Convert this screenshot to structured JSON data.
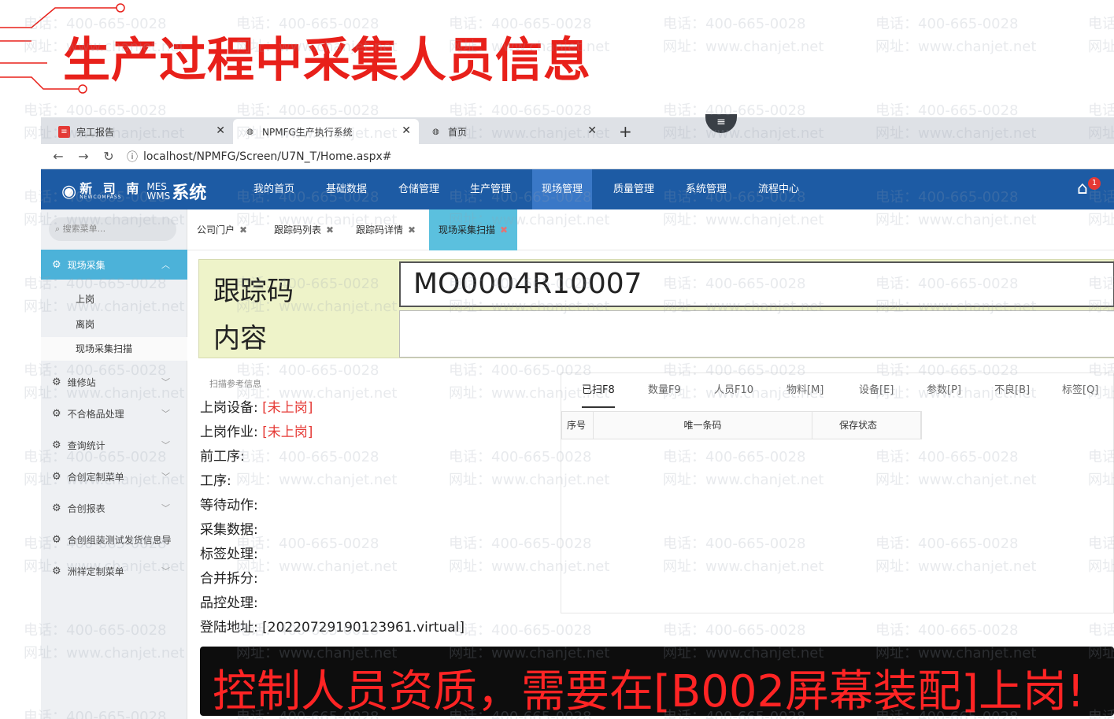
{
  "slide_title": "生产过程中采集人员信息",
  "watermark": {
    "phone": "电话：400-665-0028",
    "site": "网址：www.chanjet.net"
  },
  "browser": {
    "tabs": [
      {
        "label": "完工报告",
        "icon": "app-favicon-red"
      },
      {
        "label": "NPMFG生产执行系统",
        "icon": "globe-icon"
      },
      {
        "label": "首页",
        "icon": "globe-icon"
      }
    ],
    "new_tab_label": "+",
    "url": "localhost/NPMFG/Screen/U7N_T/Home.aspx#"
  },
  "app": {
    "logo": {
      "brand": "新 司 南",
      "brand_en": "NEWCOMPASS",
      "mes": "MES",
      "wms": "WMS",
      "system": "系统"
    },
    "nav": [
      "我的首页",
      "基础数据",
      "仓储管理",
      "生产管理",
      "现场管理",
      "质量管理",
      "系统管理",
      "流程中心"
    ],
    "active_nav": "现场管理",
    "notification_count": "1",
    "search_placeholder": "搜索菜单...",
    "sidebar": [
      {
        "label": "现场采集",
        "children": [
          "上岗",
          "离岗",
          "现场采集扫描"
        ]
      },
      {
        "label": "维修站"
      },
      {
        "label": "不合格品处理"
      },
      {
        "label": "查询统计"
      },
      {
        "label": "合创定制菜单"
      },
      {
        "label": "合创报表"
      },
      {
        "label": "合创组装测试发货信息导"
      },
      {
        "label": "洲祥定制菜单"
      }
    ],
    "page_tabs": [
      "公司门户",
      "跟踪码列表",
      "跟踪码详情",
      "现场采集扫描"
    ],
    "scan": {
      "trace_label": "跟踪码",
      "content_label": "内容",
      "trace_value": "MO0004R10007"
    },
    "info": {
      "title": "扫描参考信息",
      "rows": [
        {
          "label": "上岗设备:",
          "value": "[未上岗]"
        },
        {
          "label": "上岗作业:",
          "value": "[未上岗]"
        },
        {
          "label": "前工序:",
          "value": ""
        },
        {
          "label": "工序:",
          "value": ""
        },
        {
          "label": "等待动作:",
          "value": ""
        },
        {
          "label": "采集数据:",
          "value": ""
        },
        {
          "label": "标签处理:",
          "value": ""
        },
        {
          "label": "合并拆分:",
          "value": ""
        },
        {
          "label": "品控处理:",
          "value": ""
        },
        {
          "label": "登陆地址:",
          "value": "[20220729190123961.virtual]"
        }
      ]
    },
    "record_tabs": [
      "已扫F8",
      "数量F9",
      "人员F10",
      "物料[M]",
      "设备[E]",
      "参数[P]",
      "不良[B]",
      "标签[Q]"
    ],
    "table_headers": [
      "序号",
      "唯一条码",
      "保存状态"
    ],
    "alert": "控制人员资质，需要在[B002屏幕装配]上岗!",
    "colors": {
      "header": "#1d5ba4",
      "active_nav": "#3a78c7",
      "sidebar_active": "#4cb2d9",
      "alert_text": "#ff2424",
      "title_red": "#e8201a",
      "scan_bg": "#eef3c9"
    }
  }
}
